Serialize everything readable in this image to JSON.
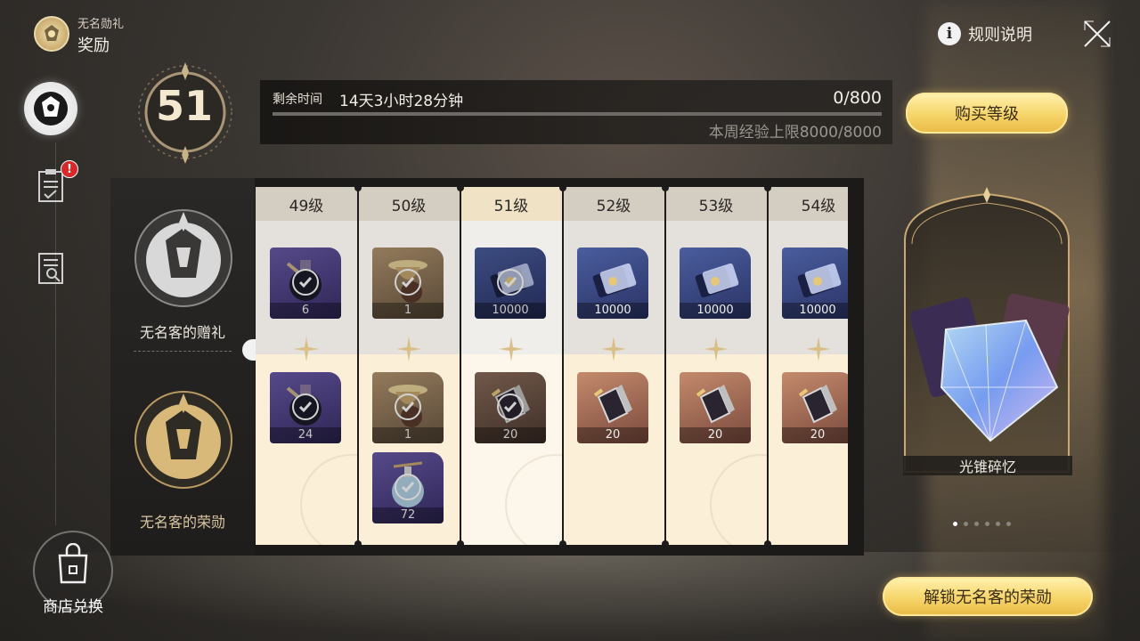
{
  "header": {
    "subtitle": "无名勋礼",
    "title": "奖励",
    "rules_label": "规则说明"
  },
  "nav": {
    "shop_label": "商店兑换",
    "alert_badge": "!"
  },
  "level": {
    "current": "51",
    "remaining_label": "剩余时间",
    "remaining_value": "14天3小时28分钟",
    "exp": "0/800",
    "exp_progress": 0,
    "weekly_cap": "本周经验上限8000/8000",
    "buy_label": "购买等级"
  },
  "tiers": {
    "free_label": "无名客的赠礼",
    "premium_label": "无名客的荣勋"
  },
  "columns": [
    {
      "label": "49级",
      "free": {
        "qty": "6",
        "color": "purple",
        "claimed": true,
        "icon": "potion-icon"
      },
      "premium": [
        {
          "qty": "24",
          "color": "purple",
          "claimed": true,
          "icon": "potion-icon"
        }
      ]
    },
    {
      "label": "50级",
      "free": {
        "qty": "1",
        "color": "brown",
        "claimed": true,
        "icon": "chalice-icon"
      },
      "premium": [
        {
          "qty": "1",
          "color": "brown",
          "claimed": true,
          "icon": "chalice-icon"
        },
        {
          "qty": "72",
          "color": "purple",
          "claimed": true,
          "icon": "flask-icon"
        }
      ]
    },
    {
      "label": "51级",
      "free": {
        "qty": "10000",
        "color": "navy",
        "claimed": true,
        "icon": "credit-icon"
      },
      "premium": [
        {
          "qty": "20",
          "color": "darkbrown",
          "claimed": true,
          "icon": "book-icon"
        }
      ],
      "current": true
    },
    {
      "label": "52级",
      "free": {
        "qty": "10000",
        "color": "navy",
        "claimed": false,
        "icon": "credit-icon"
      },
      "premium": [
        {
          "qty": "20",
          "color": "red",
          "claimed": false,
          "icon": "book-icon"
        }
      ]
    },
    {
      "label": "53级",
      "free": {
        "qty": "10000",
        "color": "navy",
        "claimed": false,
        "icon": "credit-icon"
      },
      "premium": [
        {
          "qty": "20",
          "color": "red",
          "claimed": false,
          "icon": "book-icon"
        }
      ]
    },
    {
      "label": "54级",
      "free": {
        "qty": "10000",
        "color": "navy",
        "claimed": false,
        "icon": "credit-icon"
      },
      "premium": [
        {
          "qty": "20",
          "color": "red",
          "claimed": false,
          "icon": "book-icon"
        }
      ]
    }
  ],
  "featured": {
    "label": "光锥碎忆",
    "page_count": 6,
    "active_page": 0
  },
  "unlock_label": "解锁无名客的荣勋"
}
